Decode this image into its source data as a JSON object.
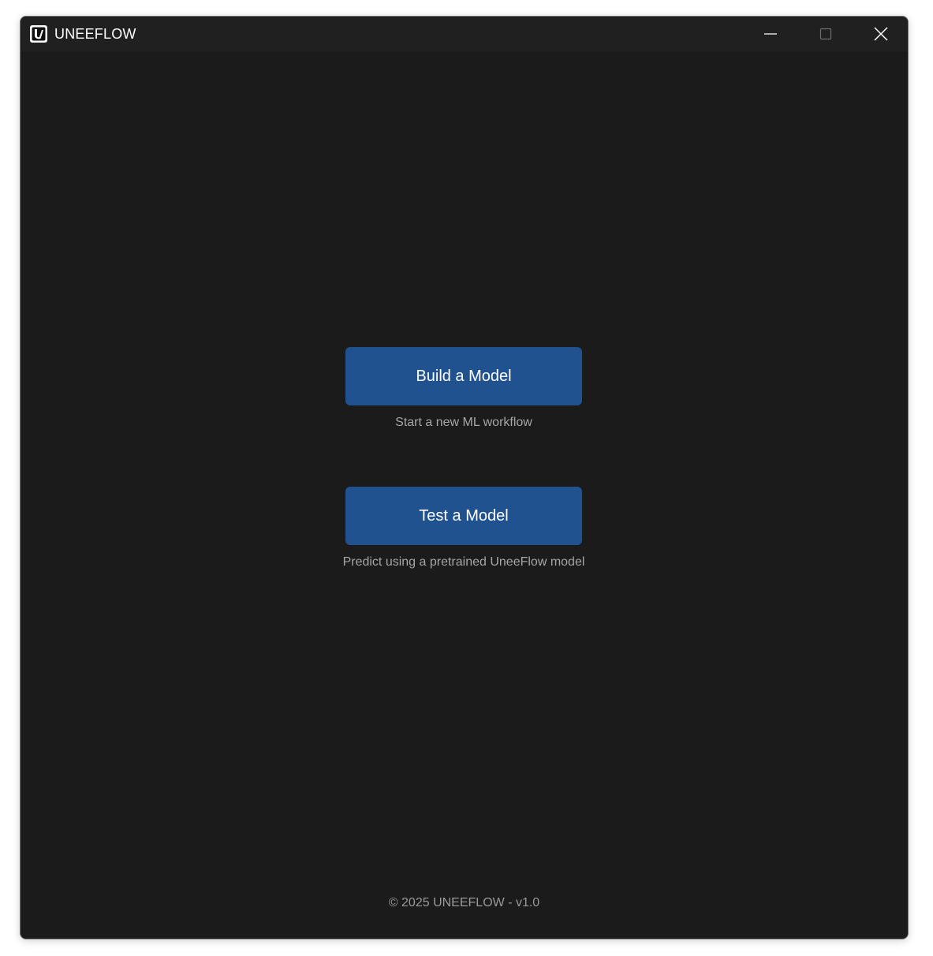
{
  "window": {
    "title": "UNEEFLOW",
    "icon": "uneeflow-logo-icon",
    "controls": {
      "minimize_icon": "minimize-icon",
      "maximize_icon": "maximize-icon",
      "close_icon": "close-icon"
    }
  },
  "main": {
    "build": {
      "label": "Build a Model",
      "caption": "Start a new ML workflow"
    },
    "test": {
      "label": "Test a Model",
      "caption": "Predict using a pretrained UneeFlow model"
    }
  },
  "footer": {
    "text": "© 2025 UNEEFLOW - v1.0"
  },
  "colors": {
    "background": "#1b1b1b",
    "titlebar": "#202020",
    "button": "#215290",
    "caption_text": "#a6a6a6"
  }
}
